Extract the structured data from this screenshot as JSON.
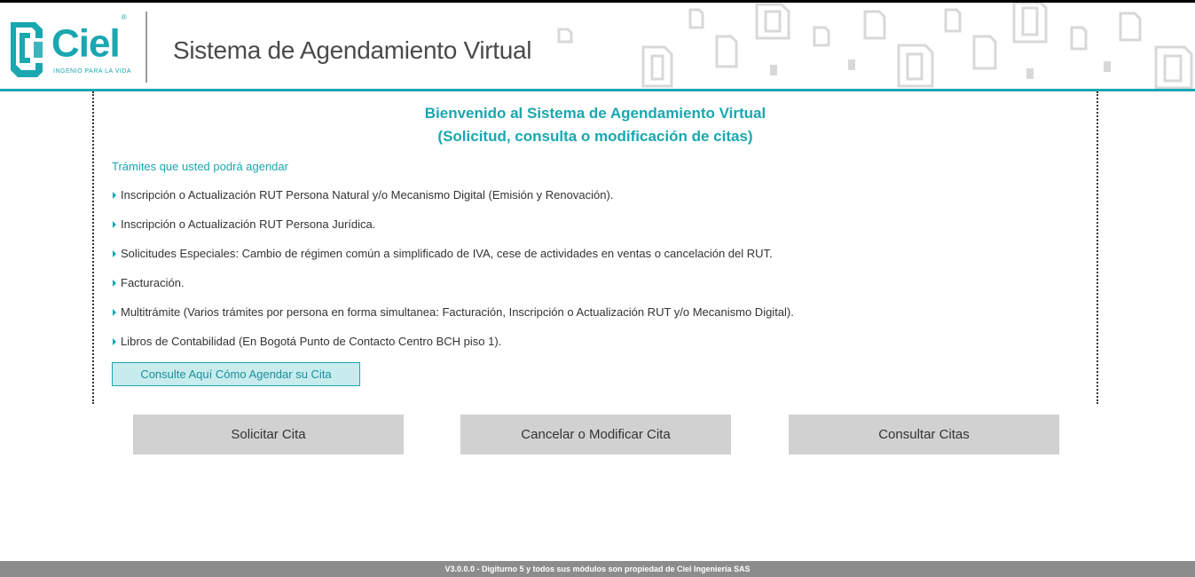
{
  "header": {
    "logo": {
      "name": "Ciel",
      "registered_mark": "®",
      "tagline": "INGENIO PARA LA VIDA"
    },
    "app_title": "Sistema de Agendamiento Virtual",
    "brand_color": "#1aa7b0"
  },
  "welcome": {
    "line1": "Bienvenido al Sistema de Agendamiento Virtual",
    "line2": "(Solicitud, consulta o modificación de citas)"
  },
  "tramites": {
    "title": "Trámites que usted podrá agendar",
    "items": [
      "Inscripción o Actualización RUT Persona Natural y/o Mecanismo Digital (Emisión y Renovación).",
      "Inscripción o Actualización RUT Persona Jurídica.",
      "Solicitudes Especiales: Cambio de régimen común a simplificado de IVA, cese de actividades en ventas o cancelación del RUT.",
      "Facturación.",
      "Multitrámite (Varios trámites por persona en forma simultanea: Facturación, Inscripción o Actualización RUT y/o Mecanismo Digital).",
      "Libros de Contabilidad (En Bogotá Punto de Contacto Centro BCH piso 1)."
    ],
    "bullet_icon": "caret-right-icon"
  },
  "help_button": {
    "label": "Consulte Aquí Cómo Agendar su Cita"
  },
  "actions": {
    "solicitar": "Solicitar Cita",
    "cancelar": "Cancelar o Modificar Cita",
    "consultar": "Consultar Citas"
  },
  "footer": {
    "text": "V3.0.0.0 - Digiturno 5 y todos sus módulos son propiedad de Ciel Ingeniería SAS"
  }
}
